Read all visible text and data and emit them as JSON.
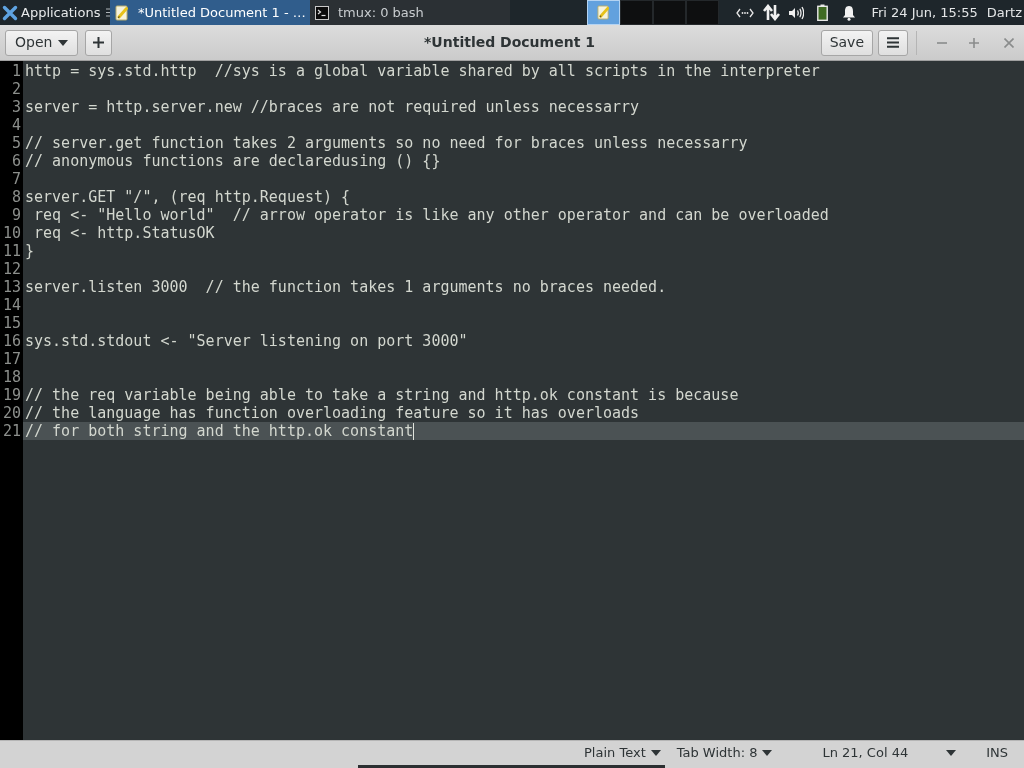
{
  "top_panel": {
    "app_menu": {
      "label": "Applications"
    },
    "tasks": [
      {
        "kind": "editor",
        "label": "*Untitled Document 1 - …",
        "selected": true
      },
      {
        "kind": "terminal",
        "label": "tmux: 0 bash",
        "selected": false
      }
    ],
    "workspaces": [
      {
        "selected": true,
        "windows": [
          {
            "kind": "editor"
          }
        ]
      },
      {
        "selected": false
      },
      {
        "selected": false
      },
      {
        "selected": false
      }
    ],
    "clock": "Fri 24 Jun, 15:55",
    "user": "Dartz"
  },
  "header_bar": {
    "open_button": {
      "label": "Open"
    },
    "title": "*Untitled Document 1",
    "save_button": {
      "label": "Save"
    }
  },
  "editor": {
    "lines": [
      {
        "number": "1",
        "text": "http = sys.std.http  //sys is a global variable shared by all scripts in the interpreter",
        "current": false
      },
      {
        "number": "2",
        "current": false
      },
      {
        "number": "3",
        "text": "server = http.server.new //braces are not required unless necessarry",
        "current": false
      },
      {
        "number": "4",
        "current": false
      },
      {
        "number": "5",
        "text": "// server.get function takes 2 arguments so no need for braces unless necessarry",
        "current": false
      },
      {
        "number": "6",
        "text": "// anonymous functions are declaredusing () {}",
        "current": false
      },
      {
        "number": "7",
        "current": false
      },
      {
        "number": "8",
        "text": "server.GET \"/\", (req http.Request) {",
        "current": false
      },
      {
        "number": "9",
        "text": " req <- \"Hello world\"  // arrow operator is like any other operator and can be overloaded",
        "current": false
      },
      {
        "number": "10",
        "text": " req <- http.StatusOK",
        "current": false
      },
      {
        "number": "11",
        "text": "}",
        "current": false
      },
      {
        "number": "12",
        "current": false
      },
      {
        "number": "13",
        "text": "server.listen 3000  // the function takes 1 arguments no braces needed.",
        "current": false
      },
      {
        "number": "14",
        "current": false
      },
      {
        "number": "15",
        "current": false
      },
      {
        "number": "16",
        "text": "sys.std.stdout <- \"Server listening on port 3000\"",
        "current": false
      },
      {
        "number": "17",
        "current": false
      },
      {
        "number": "18",
        "current": false
      },
      {
        "number": "19",
        "text": "// the req variable being able to take a string and http.ok constant is because",
        "current": false
      },
      {
        "number": "20",
        "text": "// the language has function overloading feature so it has overloads",
        "current": false
      },
      {
        "number": "21",
        "text": "// for both string and the http.ok constant",
        "current": true
      }
    ]
  },
  "status_bar": {
    "language": {
      "label": "Plain Text"
    },
    "tab_width": {
      "label": "Tab Width: 8"
    },
    "position": "Ln 21, Col 44",
    "mode": "INS"
  }
}
